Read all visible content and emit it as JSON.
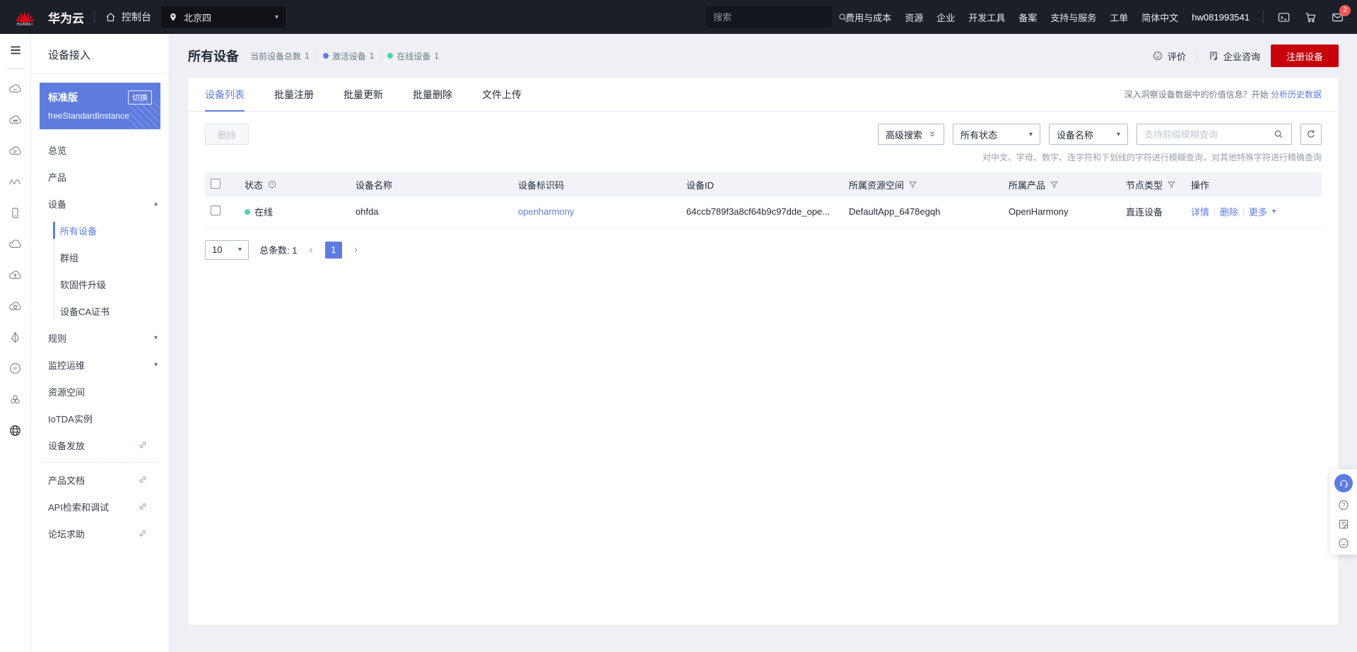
{
  "topbar": {
    "brand": "华为云",
    "console": "控制台",
    "region": "北京四",
    "search_placeholder": "搜索",
    "menu": [
      "费用与成本",
      "资源",
      "企业",
      "开发工具",
      "备案",
      "支持与服务",
      "工单",
      "简体中文"
    ],
    "username": "hw081993541",
    "badge_count": "2"
  },
  "sidebar": {
    "title": "设备接入",
    "instance": {
      "edition": "标准版",
      "switch_label": "切换",
      "name": "freeStandardInstance"
    },
    "nav": {
      "overview": "总览",
      "products": "产品",
      "devices": "设备",
      "all_devices": "所有设备",
      "groups": "群组",
      "firmware_upgrade": "软固件升级",
      "device_ca": "设备CA证书",
      "rules": "规则",
      "monitoring": "监控运维",
      "resource_spaces": "资源空间",
      "iotda_instances": "IoTDA实例",
      "device_provisioning": "设备发放",
      "product_docs": "产品文档",
      "api_explorer": "API检索和调试",
      "forum": "论坛求助"
    }
  },
  "page": {
    "title": "所有设备",
    "stats": {
      "total_label": "当前设备总数",
      "total_value": "1",
      "activated_label": "激活设备",
      "activated_value": "1",
      "online_label": "在线设备",
      "online_value": "1"
    },
    "actions": {
      "feedback": "评价",
      "consult": "企业咨询",
      "register": "注册设备"
    }
  },
  "tabs": {
    "device_list": "设备列表",
    "batch_register": "批量注册",
    "batch_update": "批量更新",
    "batch_delete": "批量删除",
    "file_upload": "文件上传"
  },
  "insight": {
    "text": "深入洞察设备数据中的价值信息？开始",
    "link": "分析历史数据"
  },
  "toolbar": {
    "delete_label": "删除",
    "advanced_search": "高级搜索",
    "status_filter": "所有状态",
    "field_filter": "设备名称",
    "search_placeholder": "支持前缀模糊查询",
    "hint": "对中文、字母、数字、连字符和下划线的字符进行模糊查询，对其他特殊字符进行精确查询"
  },
  "table": {
    "columns": {
      "status": "状态",
      "device_name": "设备名称",
      "node_id": "设备标识码",
      "device_id": "设备ID",
      "resource_space": "所属资源空间",
      "product": "所属产品",
      "node_type": "节点类型",
      "actions": "操作"
    },
    "row": {
      "status": "在线",
      "device_name": "ohfda",
      "node_id": "openharmony",
      "device_id": "64ccb789f3a8cf64b9c97dde_ope...",
      "resource_space": "DefaultApp_6478egqh",
      "product": "OpenHarmony",
      "node_type": "直连设备",
      "action_detail": "详情",
      "action_delete": "删除",
      "action_more": "更多"
    }
  },
  "pagination": {
    "page_size": "10",
    "total_label": "总条数:",
    "total_value": "1",
    "page": "1"
  },
  "icons": {
    "caret_down": "▾",
    "caret_up": "▴",
    "prev": "‹",
    "next": "›"
  },
  "colors": {
    "accent": "#5e7ce0",
    "brand_red": "#c7000b",
    "online_green": "#50d4ab",
    "activated_blue": "#5e7ce0",
    "badge_red": "#f45656"
  }
}
